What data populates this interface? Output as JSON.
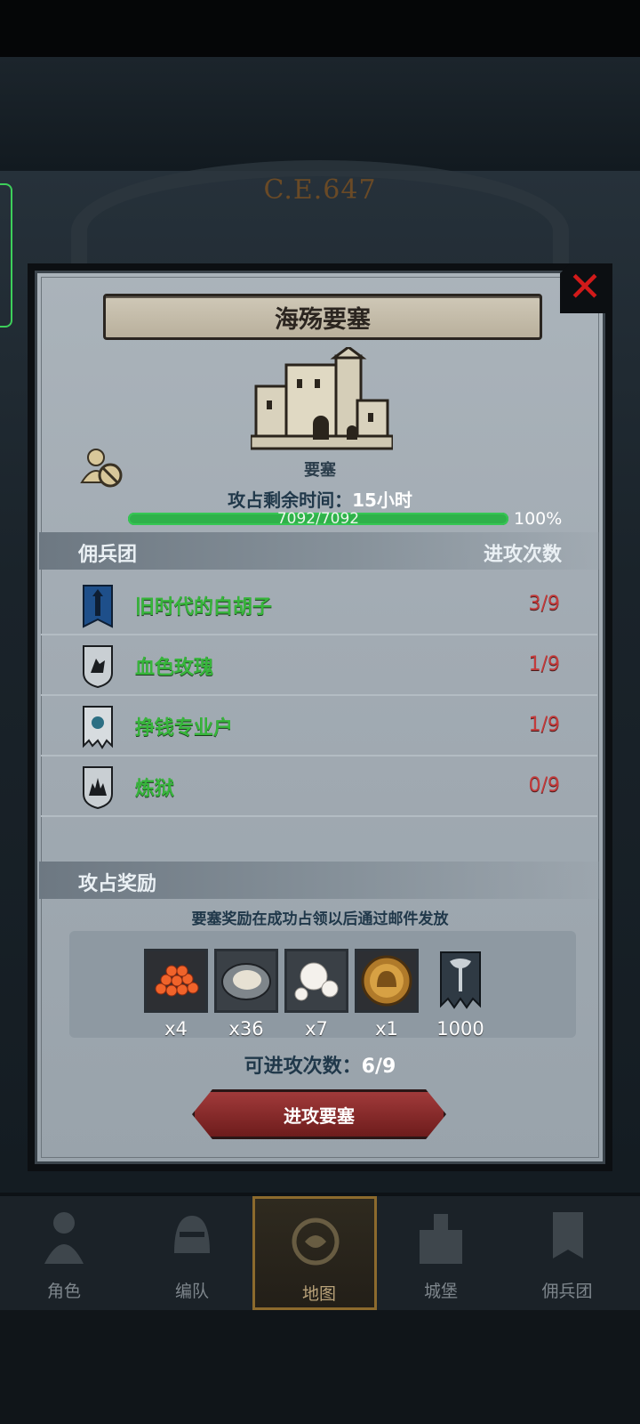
{
  "header": {
    "era": "C.E.647"
  },
  "dialog": {
    "title": "海殇要塞",
    "building_label": "要塞",
    "time_label": "攻占剩余时间：",
    "time_value": "15小时",
    "hp_text": "7092/7092",
    "hp_percent": "100%",
    "hp_fraction": 1.0,
    "close_icon": "close-x-icon"
  },
  "mercenaries": {
    "header_left": "佣兵团",
    "header_right": "进攻次数",
    "rows": [
      {
        "name": "旧时代的白胡子",
        "count": "3/9",
        "icon": "blue-tower-banner-icon"
      },
      {
        "name": "血色玫瑰",
        "count": "1/9",
        "icon": "wolf-shield-icon"
      },
      {
        "name": "挣钱专业户",
        "count": "1/9",
        "icon": "torn-banner-icon"
      },
      {
        "name": "炼狱",
        "count": "0/9",
        "icon": "flame-shield-icon"
      }
    ]
  },
  "rewards": {
    "header": "攻占奖励",
    "notice": "要塞奖励在成功占领以后通过邮件发放",
    "items": [
      {
        "icon": "fish-roe-icon",
        "qty": "x4"
      },
      {
        "icon": "oyster-icon",
        "qty": "x36"
      },
      {
        "icon": "pearl-icon",
        "qty": "x7"
      },
      {
        "icon": "gold-helmet-coin-icon",
        "qty": "x1"
      },
      {
        "icon": "axe-banner-icon",
        "qty": "1000"
      }
    ]
  },
  "attacks": {
    "label": "可进攻次数：",
    "value": "6/9"
  },
  "attack_button": "进攻要塞",
  "nav": {
    "items": [
      {
        "label": "角色",
        "icon": "knight-icon"
      },
      {
        "label": "编队",
        "icon": "helmet-icon"
      },
      {
        "label": "地图",
        "icon": "compass-map-icon"
      },
      {
        "label": "城堡",
        "icon": "castle-icon"
      },
      {
        "label": "佣兵团",
        "icon": "banner-icon"
      }
    ],
    "active": "地图"
  }
}
